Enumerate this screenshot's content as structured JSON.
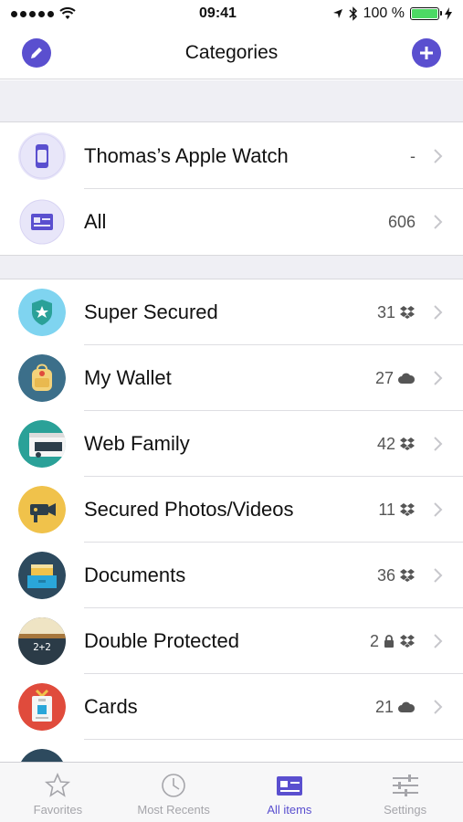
{
  "status_bar": {
    "time": "09:41",
    "battery": "100 %"
  },
  "nav": {
    "title": "Categories",
    "left_icon": "pencil-icon",
    "right_icon": "plus-icon"
  },
  "devices": [
    {
      "label": "Thomas’s Apple Watch",
      "count": "-",
      "icon": "watch-icon"
    },
    {
      "label": "All",
      "count": "606",
      "icon": "id-card-icon"
    }
  ],
  "categories": [
    {
      "label": "Super Secured",
      "count": "31",
      "sync": "dropbox-icon",
      "icon": "shield-star-icon",
      "color": "#7fd4f0"
    },
    {
      "label": "My Wallet",
      "count": "27",
      "sync": "cloud-icon",
      "icon": "backpack-icon",
      "color": "#3c6f8a"
    },
    {
      "label": "Web Family",
      "count": "42",
      "sync": "dropbox-icon",
      "icon": "browser-window-icon",
      "color": "#2aa198"
    },
    {
      "label": "Secured Photos/Videos",
      "count": "11",
      "sync": "dropbox-icon",
      "icon": "camera-icon",
      "color": "#f0c24b"
    },
    {
      "label": "Documents",
      "count": "36",
      "sync": "dropbox-icon",
      "icon": "folder-drawer-icon",
      "color": "#2d4a5e"
    },
    {
      "label": "Double Protected",
      "count": "2",
      "sync": "dropbox-icon",
      "lock": "lock-icon",
      "icon": "chalkboard-icon",
      "color": "#2b3b47",
      "board_text": "2+2"
    },
    {
      "label": "Cards",
      "count": "21",
      "sync": "cloud-icon",
      "icon": "badge-icon",
      "color": "#e04b3c"
    }
  ],
  "tabs": [
    {
      "label": "Favorites",
      "icon": "star-icon",
      "active": false
    },
    {
      "label": "Most Recents",
      "icon": "clock-icon",
      "active": false
    },
    {
      "label": "All items",
      "icon": "id-card-icon",
      "active": true
    },
    {
      "label": "Settings",
      "icon": "sliders-icon",
      "active": false
    }
  ],
  "colors": {
    "accent": "#5a4fcf",
    "section_bg": "#efeff4",
    "tab_inactive": "#a5a5aa"
  }
}
